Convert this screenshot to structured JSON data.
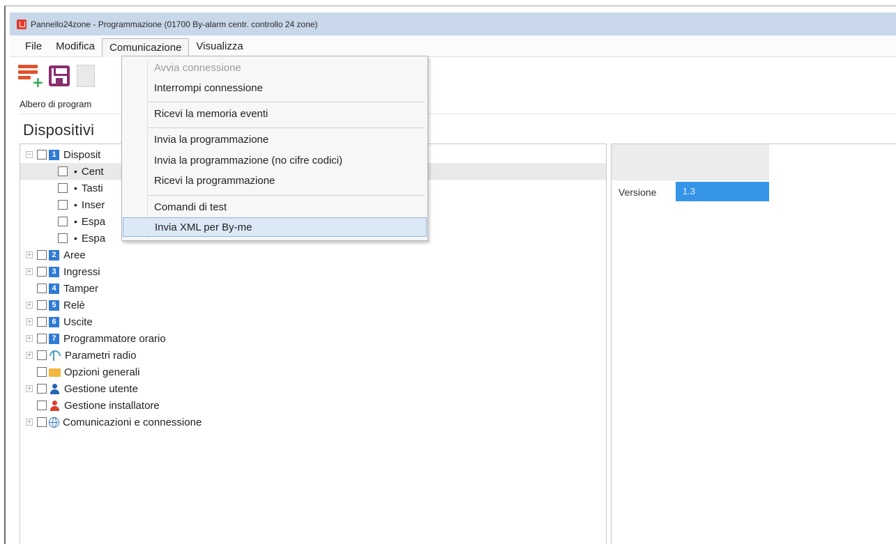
{
  "window": {
    "title": "Pannello24zone - Programmazione (01700  By-alarm centr. controllo 24 zone)"
  },
  "menubar": {
    "items": [
      "File",
      "Modifica",
      "Comunicazione",
      "Visualizza"
    ]
  },
  "toolbar": {
    "buttons": [
      "new-program-icon",
      "save-icon",
      "document-icon"
    ]
  },
  "tree_label": "Albero di program",
  "section_title": "Dispositivi",
  "tree": {
    "root": {
      "num": "1",
      "label": "Disposit"
    },
    "children": [
      {
        "label": "Cent"
      },
      {
        "label": "Tasti"
      },
      {
        "label": "Inser"
      },
      {
        "label": "Espa"
      },
      {
        "label": "Espa"
      }
    ],
    "nodes": [
      {
        "num": "2",
        "label": "Aree"
      },
      {
        "num": "3",
        "label": "Ingressi"
      },
      {
        "num": "4",
        "label": "Tamper"
      },
      {
        "num": "5",
        "label": "Relè"
      },
      {
        "num": "6",
        "label": "Uscite"
      },
      {
        "num": "7",
        "label": "Programmatore orario"
      }
    ],
    "icon_nodes": [
      {
        "icon": "antenna-icon",
        "label": "Parametri radio"
      },
      {
        "icon": "folder-icon",
        "label": "Opzioni generali"
      },
      {
        "icon": "user-icon",
        "label": "Gestione utente"
      },
      {
        "icon": "installer-icon",
        "label": "Gestione installatore"
      },
      {
        "icon": "globe-icon",
        "label": "Comunicazioni e connessione"
      }
    ]
  },
  "properties": {
    "version_label": "Versione",
    "version_value": "1.3"
  },
  "dropdown": {
    "items": [
      {
        "label": "Avvia connessione",
        "disabled": true
      },
      {
        "label": "Interrompi connessione"
      },
      {
        "label": "Ricevi la memoria eventi"
      },
      {
        "label": "Invia la programmazione"
      },
      {
        "label": "Invia la programmazione (no cifre codici)"
      },
      {
        "label": "Ricevi la programmazione"
      },
      {
        "label": "Comandi di test"
      },
      {
        "label": "Invia XML per By-me",
        "highlighted": true
      }
    ]
  },
  "colors": {
    "titlebar": "#c9d7ea",
    "selection": "#3595e8",
    "menu_highlight": "#dbe8f6",
    "tree_number": "#2f7bd4"
  }
}
